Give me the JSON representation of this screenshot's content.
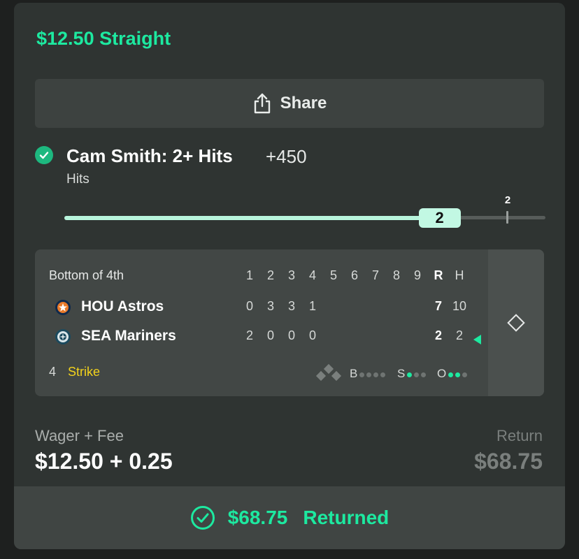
{
  "bet": {
    "title": "$12.50 Straight",
    "share_label": "Share",
    "pick_title": "Cam Smith: 2+ Hits",
    "pick_odds": "+450",
    "pick_market": "Hits",
    "progress_current": "2",
    "progress_target": "2",
    "progress_fraction": 0.78
  },
  "scoreboard": {
    "status": "Bottom of 4th",
    "innings": [
      "1",
      "2",
      "3",
      "4",
      "5",
      "6",
      "7",
      "8",
      "9"
    ],
    "runs_header": "R",
    "hits_header": "H",
    "teams": [
      {
        "name": "HOU Astros",
        "logo": "astros-logo",
        "scores": [
          "0",
          "3",
          "3",
          "1"
        ],
        "runs": "7",
        "hits": "10"
      },
      {
        "name": "SEA Mariners",
        "logo": "mariners-logo",
        "scores": [
          "2",
          "0",
          "0",
          "0"
        ],
        "runs": "2",
        "hits": "2",
        "batting": true
      }
    ],
    "last_play_number": "4",
    "last_play_event": "Strike",
    "count": {
      "balls_label": "B",
      "strikes_label": "S",
      "outs_label": "O",
      "balls": 0,
      "strikes": 1,
      "outs": 2
    }
  },
  "footer": {
    "wager_label": "Wager + Fee",
    "wager_value": "$12.50 + 0.25",
    "return_label": "Return",
    "return_value": "$68.75",
    "returned_amount": "$68.75",
    "returned_status": "Returned"
  },
  "colors": {
    "accent": "#1de9a0",
    "event": "#f2d21c",
    "card": "#2f3432"
  }
}
